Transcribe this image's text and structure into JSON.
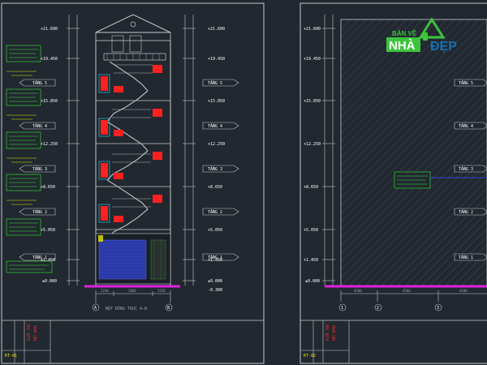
{
  "colors": {
    "background": "#212830",
    "frame": "#c8c8c8",
    "stair_red": "#ff2020",
    "ground_magenta": "#e020e0",
    "note_green": "#38e838",
    "note_cyan": "#2ad4ff",
    "pool_blue": "#2a3aa8",
    "brand_green": "#3cc43c",
    "brand_blue": "#1a6fb0"
  },
  "logo": {
    "line1": "BẢN VẼ",
    "part1": "NHÀ",
    "part2": "ĐẸP"
  },
  "left_sheet": {
    "elevations_left": [
      "+21.600",
      "+19.450",
      "+15.850",
      "+12.250",
      "+8.650",
      "+5.050",
      "+1.450",
      "±0.000"
    ],
    "elevations_right": [
      "+21.600",
      "+19.450",
      "+15.850",
      "+12.250",
      "+8.650",
      "+5.050",
      "+1.450",
      "±0.000",
      "-0.300"
    ],
    "floor_tags": [
      "TẦNG 5",
      "TẦNG 4",
      "TẦNG 3",
      "TẦNG 2",
      "TẦNG 1"
    ],
    "axis_a": "A",
    "axis_b": "B",
    "dims_bottom": [
      "1250",
      "2800",
      "1250"
    ],
    "title": "MẶT ĐỨNG TRỤC A-B",
    "sheet_code": "KT-01"
  },
  "right_sheet": {
    "elevations": [
      "+21.600",
      "+19.450",
      "+15.850",
      "+12.250",
      "+8.650",
      "+5.050",
      "+1.450",
      "±0.000"
    ],
    "floor_tags": [
      "TẦNG 5",
      "TẦNG 4",
      "TẦNG 3",
      "TẦNG 2",
      "TẦNG 1"
    ],
    "axes": [
      "1",
      "2",
      "3"
    ],
    "dims_bottom": [
      "4500",
      "4500",
      "4500"
    ],
    "sheet_code": "KT-02"
  }
}
